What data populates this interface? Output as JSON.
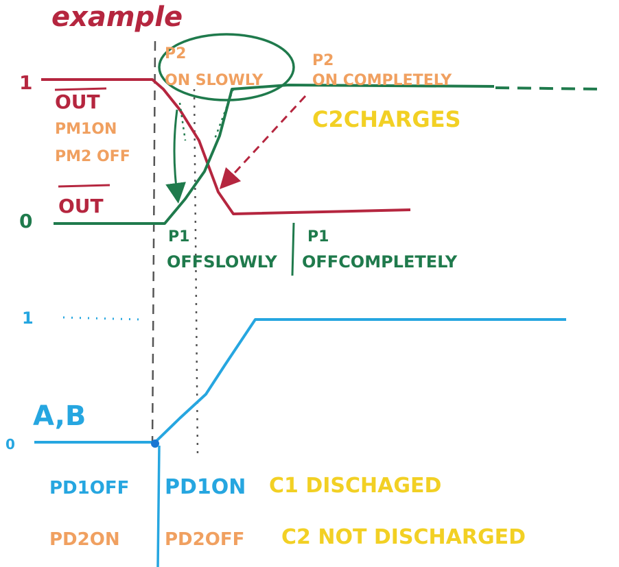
{
  "colors": {
    "red": "#b5263f",
    "green": "#1f7a4c",
    "orange": "#f0a060",
    "yellow": "#f2d024",
    "blue": "#26a6e0",
    "gray": "#555555"
  },
  "title": "example",
  "top_panel": {
    "level_1": "1",
    "level_0": "0",
    "out_label": "OUT",
    "pm1_on": "PM1ON",
    "pm2_off": "PM2 OFF",
    "out_bar_label": "OUT",
    "p2_on_slowly_line1": "P2",
    "p2_on_slowly_line2": "ON SLOWLY",
    "p2_on_completely_line1": "P2",
    "p2_on_completely_line2": "ON COMPLETELY",
    "c2_charges": "C2CHARGES",
    "p1_off_slowly_line1": "P1",
    "p1_off_slowly_line2": "OFFSLOWLY",
    "p1_off_completely_line1": "P1",
    "p1_off_completely_line2": "OFFCOMPLETELY"
  },
  "bottom_panel": {
    "level_1": "1",
    "level_0": "0",
    "input_label": "A,B",
    "pd1_off": "PD1OFF",
    "pd1_on": "PD1ON",
    "c1_discharged": "C1 DISCHAGED",
    "pd2_on": "PD2ON",
    "pd2_off": "PD2OFF",
    "c2_not_discharged": "C2 NOT DISCHARGED"
  }
}
